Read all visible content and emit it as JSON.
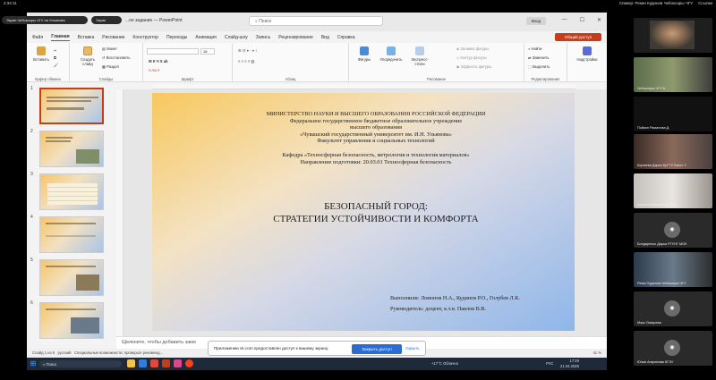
{
  "system": {
    "time": "2:34:11",
    "user_label": "Спикер: Рекин Кудинов Чебоксары ЧГУ",
    "links_label": "Ссылки"
  },
  "share": {
    "pill1": "Экран Чебоксары ЧГУ на Ульянова",
    "pill2": "Экран"
  },
  "ppt": {
    "window_title": "...ое задание — PowerPoint",
    "search_placeholder": "Поиск",
    "signin": "Вход",
    "share_button": "Общий доступ",
    "menu": [
      "Файл",
      "Главная",
      "Вставка",
      "Рисование",
      "Конструктор",
      "Переходы",
      "Анимация",
      "Слайд-шоу",
      "Запись",
      "Рецензирование",
      "Вид",
      "Справка"
    ],
    "ribbon": {
      "paste": "Вставить",
      "clipboard": "Буфер обмена",
      "new_slide": "Создать слайд",
      "layout": "Макет",
      "reset": "Восстановить",
      "section": "Раздел",
      "slides": "Слайды",
      "font": "Шрифт",
      "paragraph": "Абзац",
      "shapes": "Фигуры",
      "arrange": "Упорядочить",
      "quick_styles": "Экспресс-стили",
      "fill": "Заливка фигуры",
      "outline": "Контур фигуры",
      "effects": "Эффекты фигуры",
      "drawing": "Рисование",
      "find": "Найти",
      "replace": "Заменить",
      "select": "Выделить",
      "editing": "Редактирование",
      "addins": "Надстройки",
      "font_size": "18"
    },
    "thumbnails": [
      "1",
      "2",
      "3",
      "4",
      "5",
      "6"
    ],
    "slide": {
      "header": [
        "МИНИСТЕРСТВО НАУКИ И ВЫСШЕГО ОБРАЗОВАНИЯ РОССИЙСКОЙ ФЕДЕРАЦИИ",
        "Федеральное государственное бюджетное образовательное учреждение",
        "высшего образования",
        "«Чувашский государственный университет им. И.Н. Ульянова»",
        "Факультет управления и социальных технологий"
      ],
      "dept": [
        "Кафедра «Техносферная безопасность, метрология и технология материалов»",
        "Направление подготовки: 20.03.01 Техносферная безопасность"
      ],
      "title1": "БЕЗОПАСНЫЙ ГОРОД:",
      "title2": "СТРАТЕГИИ УСТОЙЧИВОСТИ И КОМФОРТА",
      "authors": "Выполнили: Ломонов Н.А., Кудинов Р.О., Голубев Л.К.",
      "supervisor": "Руководитель: доцент, к.т.н. Павлов В.В."
    },
    "notes_placeholder": "Щелкните, чтобы добавить заме",
    "status_left": "Слайд 1 из 8",
    "status_lang": "русский",
    "status_access": "Специальные возможности: проверьте рекоменд...",
    "zoom": "41 %"
  },
  "notice": {
    "message": "Приложению vk.com предоставлен доступ к вашему экрану.",
    "close_access": "Закрыть доступ",
    "hide": "Скрыть"
  },
  "taskbar": {
    "search": "Поиск",
    "weather": "+17°C Облачно",
    "lang": "РУС",
    "time": "17:29",
    "date": "21.04.2026"
  },
  "participants": [
    {
      "name": ""
    },
    {
      "name": "Чебоксары ЧГУ Б..."
    },
    {
      "name": "Пойкин Рамилова Д."
    },
    {
      "name": "Шулаева Дарья БрГТУ Брест 2"
    },
    {
      "name": "Арина Машкина БрГТУ Д"
    },
    {
      "name": "Бондаренко Дарья РГУНГ МОК"
    },
    {
      "name": "Рекин Кудинов Чебоксары ЧГУ"
    },
    {
      "name": "Макс Лазарева"
    },
    {
      "name": "Юлия Анкранова КГЭУ"
    }
  ]
}
